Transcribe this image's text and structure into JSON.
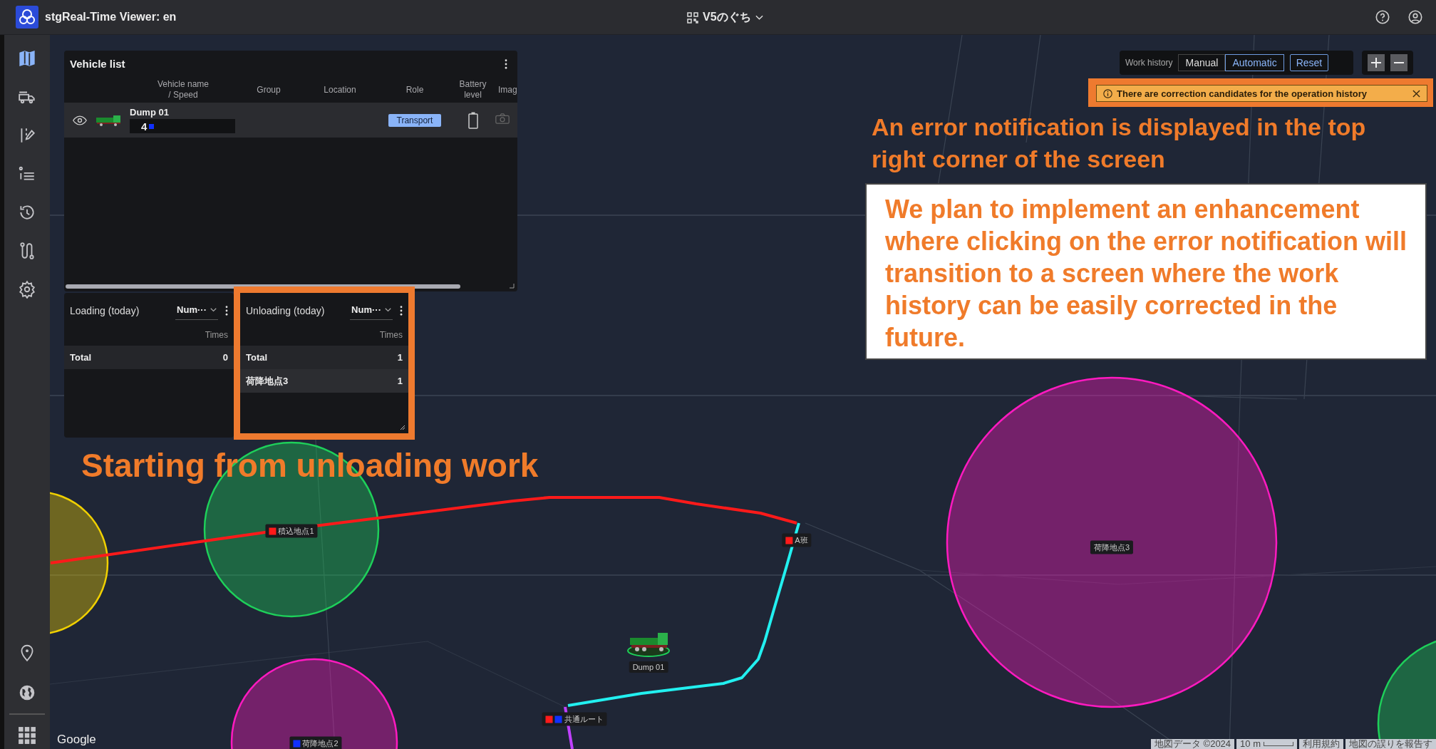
{
  "header": {
    "title": "stgReal-Time Viewer: en",
    "site": "V5のぐち"
  },
  "sidebar": {
    "items": [
      {
        "selected": true
      },
      {
        "selected": false
      },
      {
        "selected": false
      },
      {
        "selected": false
      },
      {
        "selected": false
      },
      {
        "selected": false
      },
      {
        "selected": false
      }
    ]
  },
  "vehicle_list": {
    "title": "Vehicle list",
    "columns": [
      [
        "Vehicle name",
        "/ Speed"
      ],
      [
        "Group"
      ],
      [
        "Location"
      ],
      [
        "Role"
      ],
      [
        "Battery",
        "level"
      ],
      [
        "Imag"
      ]
    ],
    "rows": [
      {
        "visible": true,
        "name": "Dump 01",
        "speed": "4",
        "role": "Transport"
      }
    ]
  },
  "loading": {
    "title": "Loading (today)",
    "metric": "Num···",
    "column": "Times",
    "rows": [
      {
        "label": "Total",
        "value": "0"
      }
    ]
  },
  "unloading": {
    "title": "Unloading (today)",
    "metric": "Num···",
    "column": "Times",
    "rows": [
      {
        "label": "Total",
        "value": "1"
      },
      {
        "label": "荷降地点3",
        "value": "1"
      }
    ]
  },
  "work_history": {
    "label": "Work history",
    "modes": [
      {
        "label": "Manual",
        "selected": false
      },
      {
        "label": "Automatic",
        "selected": true
      }
    ],
    "reset": "Reset"
  },
  "notification": {
    "text": "There are correction candidates for the operation history"
  },
  "annotations": {
    "callout": "An error notification is displayed in the top right corner of the screen",
    "note": "We plan to implement an enhancement where clicking on the error notification will transition to a screen where the work history can be easily corrected in the future.",
    "caption": "Starting from unloading work"
  },
  "map": {
    "zones": [
      {
        "color": "#f0d000"
      },
      {
        "color": "#1ed05a"
      },
      {
        "color": "#ff1ac0"
      },
      {
        "color": "#ff1ac0"
      },
      {
        "color": "#1ed05a"
      }
    ],
    "routes": [
      {
        "color": "#ff1a1a"
      },
      {
        "color": "#22f0f0"
      },
      {
        "color": "#c040ff"
      }
    ],
    "markers": [
      {
        "label": "積込地点1",
        "swatches": [
          {
            "color": "#ff1a1a"
          }
        ]
      },
      {
        "label": "A班",
        "swatches": [
          {
            "color": "#ff1a1a"
          }
        ]
      },
      {
        "label": "荷降地点3"
      },
      {
        "label": "共通ルート",
        "swatches": [
          {
            "color": "#ff1a1a"
          },
          {
            "color": "#1030ff"
          }
        ]
      },
      {
        "label": "荷降地点2",
        "swatches": [
          {
            "color": "#1030ff"
          }
        ]
      }
    ],
    "vehicle": {
      "label": "Dump 01"
    }
  },
  "attribution": {
    "provider": "Google",
    "data": "地図データ ©2024",
    "scale": "10 m",
    "terms": "利用規約",
    "report": "地図の誤りを報告す"
  }
}
